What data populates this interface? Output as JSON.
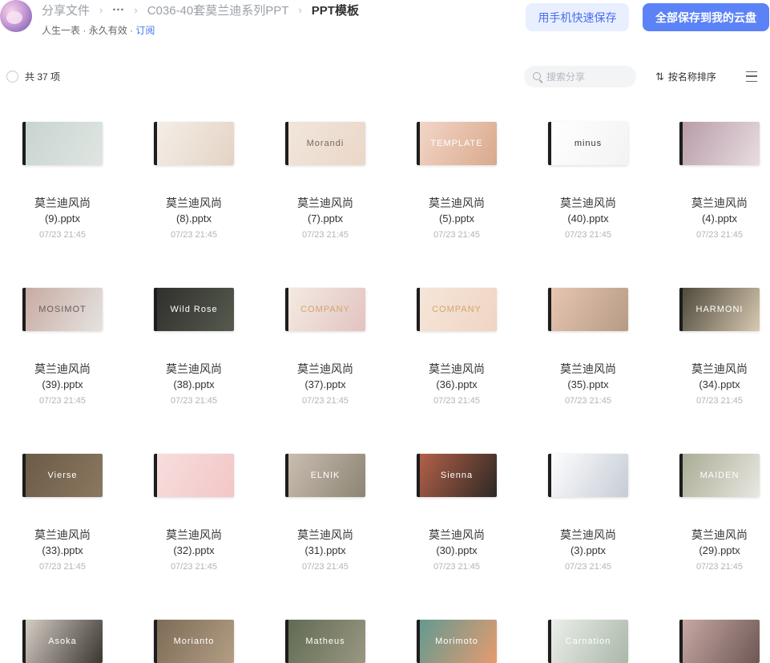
{
  "header": {
    "breadcrumb": [
      "分享文件",
      "···",
      "C036-40套莫兰迪系列PPT",
      "PPT模板"
    ],
    "separator": "›",
    "sub_user": "人生一表",
    "sub_validity": "永久有效",
    "sub_dot": "·",
    "sub_subscribe": "订阅",
    "btn_phone_save": "用手机快速保存",
    "btn_save_all": "全部保存到我的云盘"
  },
  "toolbar": {
    "count": "共 37 项",
    "search_placeholder": "搜索分享",
    "sort_label": "按名称排序",
    "sort_icon": "⇅"
  },
  "files": [
    {
      "n1": "莫兰迪风尚",
      "n2": "(9).pptx",
      "date": "07/23 21:45",
      "thumb": "",
      "colors": [
        "#c8d3cf",
        "#dfe6e2"
      ],
      "tc": "#9b8f8a"
    },
    {
      "n1": "莫兰迪风尚",
      "n2": "(8).pptx",
      "date": "07/23 21:45",
      "thumb": "",
      "colors": [
        "#f4efe9",
        "#e4d3c4"
      ],
      "tc": "#a08c80"
    },
    {
      "n1": "莫兰迪风尚",
      "n2": "(7).pptx",
      "date": "07/23 21:45",
      "thumb": "Morandi",
      "colors": [
        "#f2e6dc",
        "#ead7c8"
      ],
      "tc": "#6e6a62"
    },
    {
      "n1": "莫兰迪风尚",
      "n2": "(5).pptx",
      "date": "07/23 21:45",
      "thumb": "TEMPLATE",
      "colors": [
        "#f3d7c9",
        "#d9a98c"
      ],
      "tc": "#ffffff"
    },
    {
      "n1": "莫兰迪风尚",
      "n2": "(40).pptx",
      "date": "07/23 21:45",
      "thumb": "minus",
      "colors": [
        "#ffffff",
        "#f3f3f3"
      ],
      "tc": "#333333"
    },
    {
      "n1": "莫兰迪风尚",
      "n2": "(4).pptx",
      "date": "07/23 21:45",
      "thumb": "",
      "colors": [
        "#b79aa6",
        "#e8dde1"
      ],
      "tc": "#ffffff"
    },
    {
      "n1": "莫兰迪风尚",
      "n2": "(39).pptx",
      "date": "07/23 21:45",
      "thumb": "MOSIMOT",
      "colors": [
        "#c7a9a0",
        "#e5e3e0"
      ],
      "tc": "#6d5c57"
    },
    {
      "n1": "莫兰迪风尚",
      "n2": "(38).pptx",
      "date": "07/23 21:45",
      "thumb": "Wild Rose",
      "colors": [
        "#2f2f2c",
        "#565a4e"
      ],
      "tc": "#ffffff"
    },
    {
      "n1": "莫兰迪风尚",
      "n2": "(37).pptx",
      "date": "07/23 21:45",
      "thumb": "COMPANY",
      "colors": [
        "#f4ece3",
        "#e3c3c1"
      ],
      "tc": "#d4a36e"
    },
    {
      "n1": "莫兰迪风尚",
      "n2": "(36).pptx",
      "date": "07/23 21:45",
      "thumb": "COMPANY",
      "colors": [
        "#f5e7da",
        "#f0d4c3"
      ],
      "tc": "#d4a36e"
    },
    {
      "n1": "莫兰迪风尚",
      "n2": "(35).pptx",
      "date": "07/23 21:45",
      "thumb": "",
      "colors": [
        "#e8c7b3",
        "#b69b84"
      ],
      "tc": "#ffffff"
    },
    {
      "n1": "莫兰迪风尚",
      "n2": "(34).pptx",
      "date": "07/23 21:45",
      "thumb": "HARMONI",
      "colors": [
        "#4a4638",
        "#d8c9b1"
      ],
      "tc": "#ffffff"
    },
    {
      "n1": "莫兰迪风尚",
      "n2": "(33).pptx",
      "date": "07/23 21:45",
      "thumb": "Vierse",
      "colors": [
        "#6b5a47",
        "#8a7860"
      ],
      "tc": "#ffffff"
    },
    {
      "n1": "莫兰迪风尚",
      "n2": "(32).pptx",
      "date": "07/23 21:45",
      "thumb": "",
      "colors": [
        "#f7dede",
        "#f3c6c6"
      ],
      "tc": "#c98b8b"
    },
    {
      "n1": "莫兰迪风尚",
      "n2": "(31).pptx",
      "date": "07/23 21:45",
      "thumb": "ELNIK",
      "colors": [
        "#cbbfb1",
        "#8d8474"
      ],
      "tc": "#ffffff"
    },
    {
      "n1": "莫兰迪风尚",
      "n2": "(30).pptx",
      "date": "07/23 21:45",
      "thumb": "Sienna",
      "colors": [
        "#b7624a",
        "#2d2824"
      ],
      "tc": "#ffffff"
    },
    {
      "n1": "莫兰迪风尚",
      "n2": "(3).pptx",
      "date": "07/23 21:45",
      "thumb": "",
      "colors": [
        "#ffffff",
        "#c6ccd6"
      ],
      "tc": "#5a6270"
    },
    {
      "n1": "莫兰迪风尚",
      "n2": "(29).pptx",
      "date": "07/23 21:45",
      "thumb": "MAIDEN",
      "colors": [
        "#a8ab92",
        "#e9e7e2"
      ],
      "tc": "#ffffff"
    },
    {
      "n1": "",
      "n2": "",
      "date": "",
      "thumb": "Asoka",
      "colors": [
        "#d9d2c9",
        "#3b3530"
      ],
      "tc": "#ffffff"
    },
    {
      "n1": "",
      "n2": "",
      "date": "",
      "thumb": "Morianto",
      "colors": [
        "#7c6a55",
        "#b39e84"
      ],
      "tc": "#ffffff"
    },
    {
      "n1": "",
      "n2": "",
      "date": "",
      "thumb": "Matheus",
      "colors": [
        "#5e6a52",
        "#9b9782"
      ],
      "tc": "#ffffff"
    },
    {
      "n1": "",
      "n2": "",
      "date": "",
      "thumb": "Morimoto",
      "colors": [
        "#5f9a92",
        "#e59b6f"
      ],
      "tc": "#ffffff"
    },
    {
      "n1": "",
      "n2": "",
      "date": "",
      "thumb": "Carnation",
      "colors": [
        "#eef1ec",
        "#a9b7a8"
      ],
      "tc": "#ffffff"
    },
    {
      "n1": "",
      "n2": "",
      "date": "",
      "thumb": "",
      "colors": [
        "#c9a9a6",
        "#6d5854"
      ],
      "tc": "#ffffff"
    }
  ]
}
